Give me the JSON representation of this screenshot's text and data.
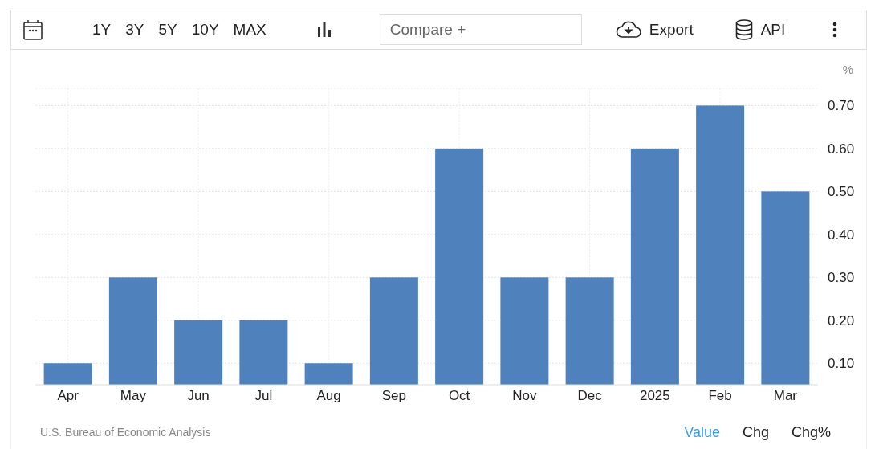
{
  "toolbar": {
    "ranges": [
      "1Y",
      "3Y",
      "5Y",
      "10Y",
      "MAX"
    ],
    "compare": {
      "placeholder": "Compare +"
    },
    "export": "Export",
    "api": "API"
  },
  "chart": {
    "unit": "%",
    "chart_data": {
      "type": "bar",
      "categories": [
        "Apr",
        "May",
        "Jun",
        "Jul",
        "Aug",
        "Sep",
        "Oct",
        "Nov",
        "Dec",
        "2025",
        "Feb",
        "Mar"
      ],
      "grid": true,
      "series": [
        {
          "color": "#4f81bd",
          "values": [
            0.1,
            0.3,
            0.2,
            0.2,
            0.1,
            0.3,
            0.6,
            0.3,
            0.3,
            0.6,
            0.7,
            0.5
          ]
        }
      ],
      "ylim": [
        0.05,
        0.74
      ],
      "yticks": [
        {
          "value": 0.1,
          "label": "0.10"
        },
        {
          "value": 0.2,
          "label": "0.20"
        },
        {
          "value": 0.3,
          "label": "0.30"
        },
        {
          "value": 0.4,
          "label": "0.40"
        },
        {
          "value": 0.5,
          "label": "0.50"
        },
        {
          "value": 0.6,
          "label": "0.60"
        },
        {
          "value": 0.7,
          "label": "0.70"
        }
      ]
    }
  },
  "footer": {
    "source": "U.S. Bureau of Economic Analysis",
    "modes": [
      {
        "label": "Value",
        "selected": true
      },
      {
        "label": "Chg",
        "selected": false
      },
      {
        "label": "Chg%",
        "selected": false
      }
    ]
  }
}
